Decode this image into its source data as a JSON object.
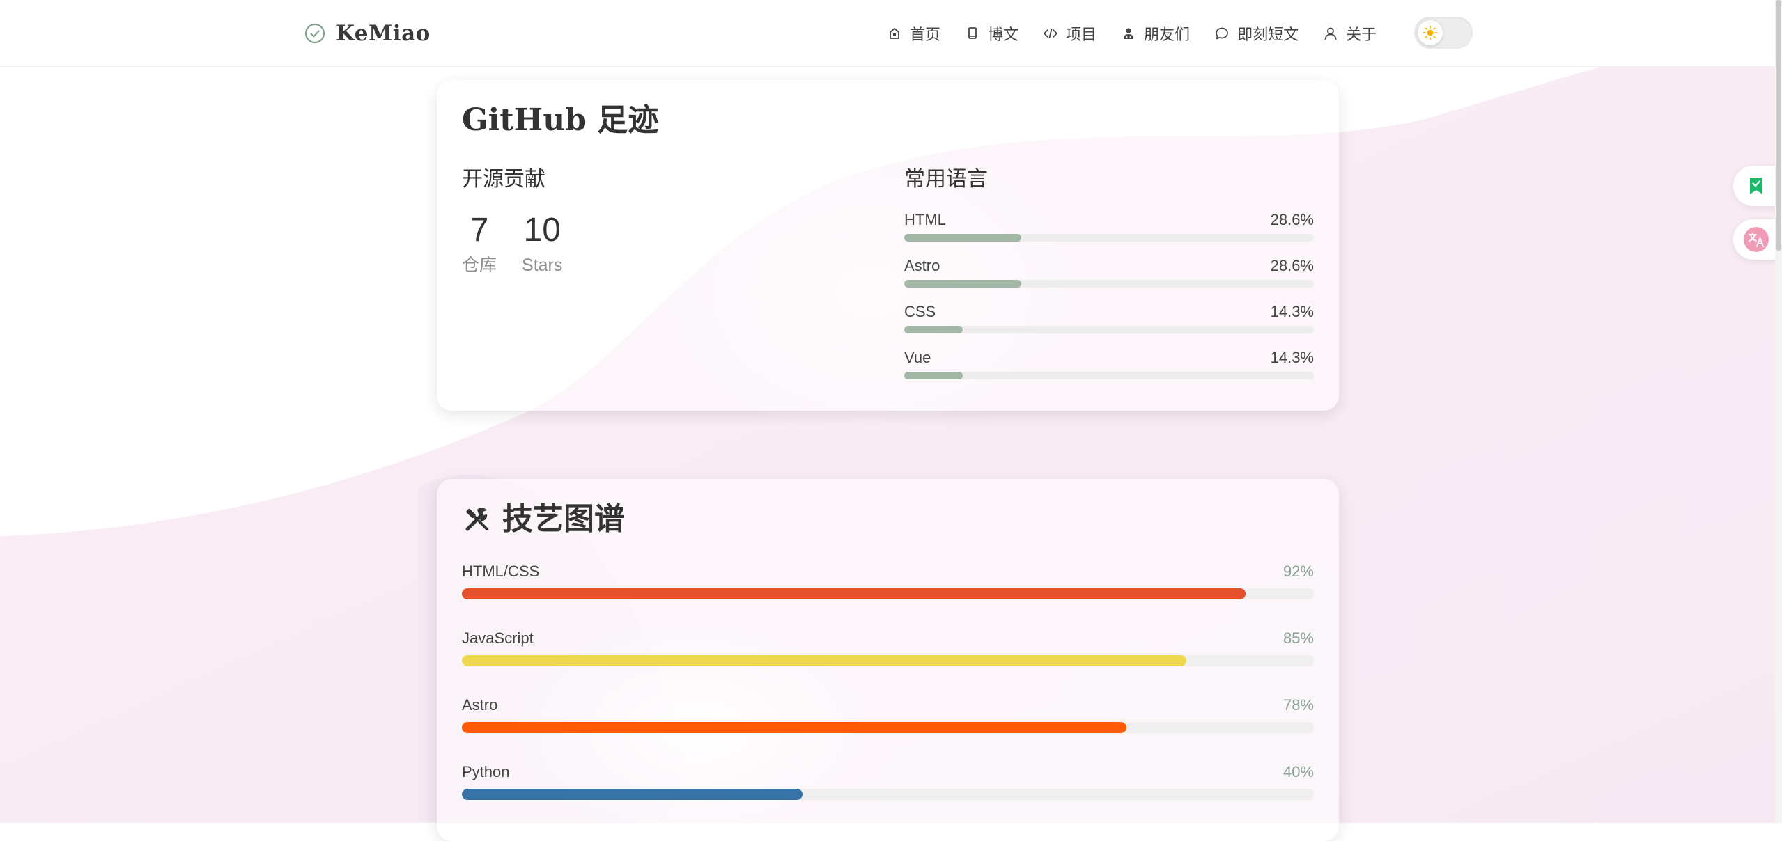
{
  "brand": {
    "name": "KeMiao",
    "icon": "check-circle-icon",
    "accent": "#7fa38b"
  },
  "nav": {
    "items": [
      {
        "label": "首页",
        "icon": "home-icon"
      },
      {
        "label": "博文",
        "icon": "book-icon"
      },
      {
        "label": "项目",
        "icon": "code-icon"
      },
      {
        "label": "朋友们",
        "icon": "friends-icon"
      },
      {
        "label": "即刻短文",
        "icon": "chat-bubble-icon"
      },
      {
        "label": "关于",
        "icon": "user-icon"
      }
    ],
    "theme_toggle": {
      "icon": "sun-icon",
      "mode": "light"
    }
  },
  "floating": {
    "bookmark": {
      "icon": "bookmark-icon",
      "color": "#1db86b"
    },
    "translate": {
      "icon": "translate-icon",
      "color": "#f09bb5"
    }
  },
  "github": {
    "title": "GitHub 足迹",
    "contributions": {
      "heading": "开源贡献",
      "stats": [
        {
          "value": "7",
          "label": "仓库"
        },
        {
          "value": "10",
          "label": "Stars"
        }
      ]
    },
    "languages": {
      "heading": "常用语言",
      "bar_color": "#a3b7a7",
      "items": [
        {
          "name": "HTML",
          "percent_text": "28.6%",
          "percent": 28.6
        },
        {
          "name": "Astro",
          "percent_text": "28.6%",
          "percent": 28.6
        },
        {
          "name": "CSS",
          "percent_text": "14.3%",
          "percent": 14.3
        },
        {
          "name": "Vue",
          "percent_text": "14.3%",
          "percent": 14.3
        }
      ]
    }
  },
  "skills": {
    "title": "技艺图谱",
    "icon": "tools-icon",
    "items": [
      {
        "name": "HTML/CSS",
        "percent_text": "92%",
        "percent": 92,
        "color": "#e4512b"
      },
      {
        "name": "JavaScript",
        "percent_text": "85%",
        "percent": 85,
        "color": "#eed94d"
      },
      {
        "name": "Astro",
        "percent_text": "78%",
        "percent": 78,
        "color": "#ff5a03"
      },
      {
        "name": "Python",
        "percent_text": "40%",
        "percent": 40,
        "color": "#3773a6"
      }
    ]
  }
}
